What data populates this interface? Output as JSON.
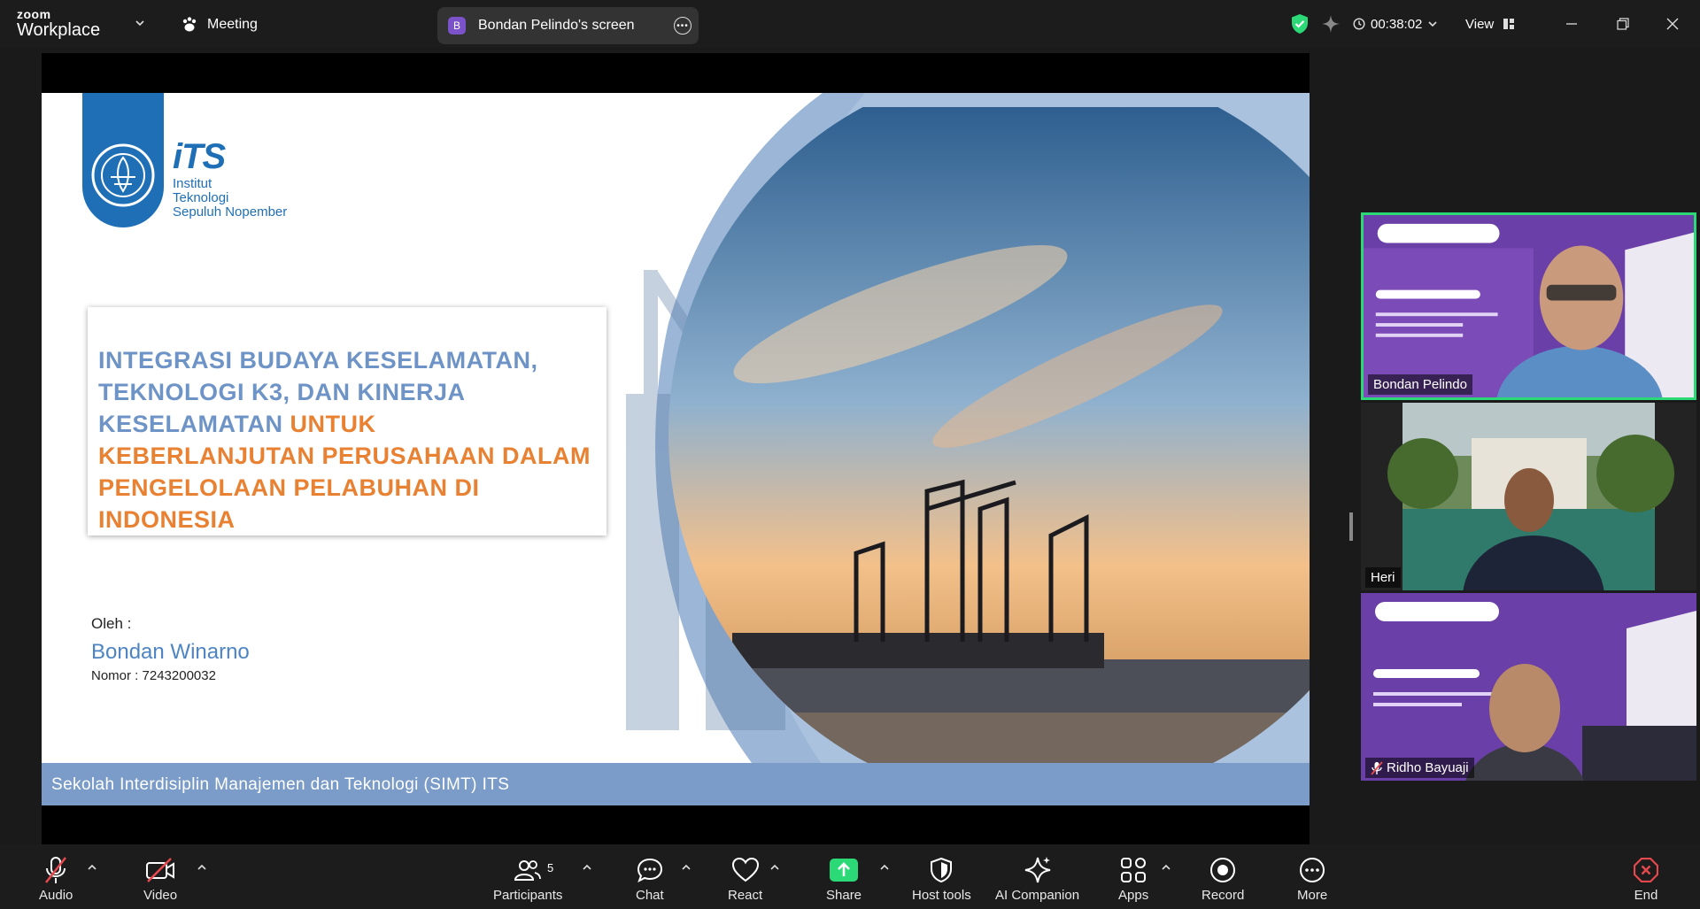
{
  "app": {
    "brand_top": "zoom",
    "brand_bottom": "Workplace"
  },
  "header": {
    "meeting_label": "Meeting",
    "share_label": "Bondan Pelindo's screen",
    "share_avatar": "B",
    "timer": "00:38:02",
    "view_label": "View"
  },
  "slide": {
    "logo_big": "iTS",
    "logo_line1": "Institut",
    "logo_line2": "Teknologi",
    "logo_line3": "Sepuluh Nopember",
    "title_blue": "INTEGRASI BUDAYA KESELAMATAN, TEKNOLOGI K3, DAN KINERJA KESELAMATAN",
    "title_orange": "UNTUK KEBERLANJUTAN PERUSAHAAN DALAM PENGELOLAAN PELABUHAN DI INDONESIA",
    "by_label": "Oleh :",
    "author": "Bondan Winarno",
    "nomor": "Nomor : 7243200032",
    "footer": "Sekolah Interdisiplin Manajemen dan Teknologi (SIMT) ITS"
  },
  "participants": [
    {
      "name": "Bondan Pelindo",
      "active_speaker": true,
      "muted": false
    },
    {
      "name": "Heri",
      "active_speaker": false,
      "muted": false
    },
    {
      "name": "Ridho Bayuaji",
      "active_speaker": false,
      "muted": true
    }
  ],
  "toolbar": {
    "audio": "Audio",
    "video": "Video",
    "participants": "Participants",
    "participants_count": "5",
    "chat": "Chat",
    "react": "React",
    "share": "Share",
    "host_tools": "Host tools",
    "ai_companion": "AI Companion",
    "apps": "Apps",
    "record": "Record",
    "more": "More",
    "end": "End"
  },
  "colors": {
    "active_speaker_border": "#2bd977",
    "share_green": "#2bd977",
    "end_red": "#e5484d",
    "slide_blue": "#6e93c6",
    "slide_orange": "#e98133",
    "its_blue": "#1f6fb6"
  }
}
